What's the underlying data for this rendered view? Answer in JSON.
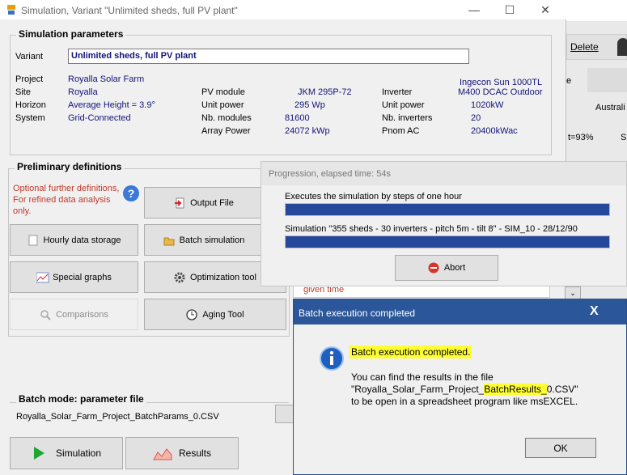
{
  "window": {
    "title": "Simulation, Variant  \"Unlimited sheds, full PV plant\"",
    "minimize": "—",
    "maximize": "☐",
    "close": "✕"
  },
  "sim_params": {
    "title": "Simulation parameters",
    "variant_label": "Variant",
    "variant_value": "Unlimited sheds, full PV plant",
    "project_label": "Project",
    "project_value": "Royalla Solar Farm",
    "site_label": "Site",
    "site_value": "Royalla",
    "horizon_label": "Horizon",
    "horizon_value": "Average Height =   3.9°",
    "system_label": "System",
    "system_value": "Grid-Connected",
    "pv_module_label": "PV module",
    "pv_module_value": "JKM 295P-72",
    "unit_power_label": "Unit power",
    "unit_power_value": "295  Wp",
    "nb_modules_label": "Nb. modules",
    "nb_modules_value": "81600",
    "array_power_label": "Array Power",
    "array_power_value": "24072  kWp",
    "inverter_label": "Inverter",
    "inverter_value_1": "Ingecon Sun 1000TL",
    "inverter_value_2": "M400 DCAC Outdoor",
    "inv_unit_power_label": "Unit power",
    "inv_unit_power_value": "1020kW",
    "nb_inverters_label": "Nb. inverters",
    "nb_inverters_value": "20",
    "pnom_ac_label": "Pnom AC",
    "pnom_ac_value": "20400kWac"
  },
  "prelim": {
    "title": "Preliminary definitions",
    "note": "Optional further definitions, For refined data analysis only.",
    "help_icon": "?",
    "output_file": "Output File",
    "hourly_data": "Hourly data storage",
    "batch_simulation": "Batch simulation",
    "special_graphs": "Special graphs",
    "optimization_tool": "Optimization tool",
    "comparisons": "Comparisons",
    "aging_tool": "Aging Tool",
    "given_time": "given time"
  },
  "batch": {
    "title": "Batch mode: parameter file",
    "file": "Royalla_Solar_Farm_Project_BatchParams_0.CSV"
  },
  "bottom": {
    "simulation": "Simulation",
    "results": "Results"
  },
  "background_right": {
    "delete": "Delete",
    "e": "e",
    "australia": "Australi",
    "eta": "t=93%",
    "s": "S"
  },
  "progress": {
    "title": "Progression, elapsed time: 54s",
    "step1": "Executes the simulation by steps of one hour",
    "step2": "Simulation \"355 sheds - 30 inverters - pitch 5m - tilt 8\" - SIM_10 - 28/12/90",
    "bar1_fill": 1.0,
    "bar2_fill": 1.0,
    "abort": "Abort"
  },
  "dialog": {
    "title": "Batch execution completed",
    "close": "X",
    "heading": "Batch execution completed.",
    "line1": "You can find the results in the file",
    "line2_pre": "\"Royalla_Solar_Farm_Project_",
    "line2_hl": "BatchResults_",
    "line2_post": "0.CSV\"",
    "line3": "to be open in a spreadsheet program like msEXCEL.",
    "ok": "OK"
  },
  "colors": {
    "progress_bar": "#26489a",
    "dialog_title": "#2b579a",
    "value_text": "#13137a",
    "note_red": "#c0392b"
  }
}
